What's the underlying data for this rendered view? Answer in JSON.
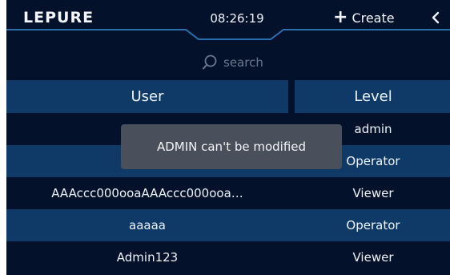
{
  "header": {
    "logo": "LEPURE",
    "clock": "08:26:19",
    "create_label": "Create"
  },
  "search": {
    "placeholder": "search"
  },
  "table": {
    "columns": [
      "User",
      "Level"
    ],
    "rows": [
      {
        "user": "",
        "level": "admin"
      },
      {
        "user": "",
        "level": "Operator"
      },
      {
        "user": "AAAccc000ooaAAAccc000ooa…",
        "level": "Viewer"
      },
      {
        "user": "aaaaa",
        "level": "Operator"
      },
      {
        "user": "Admin123",
        "level": "Viewer"
      }
    ]
  },
  "toast": {
    "message": "ADMIN can't  be modified"
  },
  "colors": {
    "background": "#04112a",
    "row_stripe": "#0f3a68",
    "accent_line": "#2a6fb0",
    "toast": "#4a505b"
  }
}
